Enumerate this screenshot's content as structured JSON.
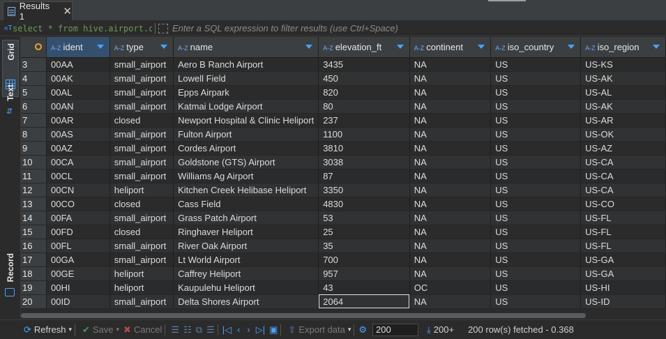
{
  "tab": {
    "label": "Results 1",
    "close": "✕"
  },
  "filter": {
    "sql": "select * from hive.airport.codes",
    "placeholder": "Enter a SQL expression to filter results (use Ctrl+Space)"
  },
  "rail": {
    "grid": "Grid",
    "text": "Text",
    "record": "Record"
  },
  "columns": [
    "ident",
    "type",
    "name",
    "elevation_ft",
    "continent",
    "iso_country",
    "iso_region"
  ],
  "rows": [
    [
      "3",
      "00AA",
      "small_airport",
      "Aero B Ranch Airport",
      "3435",
      "NA",
      "US",
      "US-KS"
    ],
    [
      "4",
      "00AK",
      "small_airport",
      "Lowell Field",
      "450",
      "NA",
      "US",
      "US-AK"
    ],
    [
      "5",
      "00AL",
      "small_airport",
      "Epps Airpark",
      "820",
      "NA",
      "US",
      "US-AL"
    ],
    [
      "6",
      "00AN",
      "small_airport",
      "Katmai Lodge Airport",
      "80",
      "NA",
      "US",
      "US-AK"
    ],
    [
      "7",
      "00AR",
      "closed",
      "Newport Hospital & Clinic Heliport",
      "237",
      "NA",
      "US",
      "US-AR"
    ],
    [
      "8",
      "00AS",
      "small_airport",
      "Fulton Airport",
      "1100",
      "NA",
      "US",
      "US-OK"
    ],
    [
      "9",
      "00AZ",
      "small_airport",
      "Cordes Airport",
      "3810",
      "NA",
      "US",
      "US-AZ"
    ],
    [
      "10",
      "00CA",
      "small_airport",
      "Goldstone (GTS) Airport",
      "3038",
      "NA",
      "US",
      "US-CA"
    ],
    [
      "11",
      "00CL",
      "small_airport",
      "Williams Ag Airport",
      "87",
      "NA",
      "US",
      "US-CA"
    ],
    [
      "12",
      "00CN",
      "heliport",
      "Kitchen Creek Helibase Heliport",
      "3350",
      "NA",
      "US",
      "US-CA"
    ],
    [
      "13",
      "00CO",
      "closed",
      "Cass Field",
      "4830",
      "NA",
      "US",
      "US-CO"
    ],
    [
      "14",
      "00FA",
      "small_airport",
      "Grass Patch Airport",
      "53",
      "NA",
      "US",
      "US-FL"
    ],
    [
      "15",
      "00FD",
      "closed",
      "Ringhaver Heliport",
      "25",
      "NA",
      "US",
      "US-FL"
    ],
    [
      "16",
      "00FL",
      "small_airport",
      "River Oak Airport",
      "35",
      "NA",
      "US",
      "US-FL"
    ],
    [
      "17",
      "00GA",
      "small_airport",
      "Lt World Airport",
      "700",
      "NA",
      "US",
      "US-GA"
    ],
    [
      "18",
      "00GE",
      "heliport",
      "Caffrey Heliport",
      "957",
      "NA",
      "US",
      "US-GA"
    ],
    [
      "19",
      "00HI",
      "heliport",
      "Kaupulehu Heliport",
      "43",
      "OC",
      "US",
      "US-HI"
    ],
    [
      "20",
      "00ID",
      "small_airport",
      "Delta Shores Airport",
      "2064",
      "NA",
      "US",
      "US-ID"
    ]
  ],
  "toolbar": {
    "refresh": "Refresh",
    "save": "Save",
    "cancel": "Cancel",
    "export": "Export data",
    "fetch_size": "200",
    "fetch_count": "200+",
    "status": "200 row(s) fetched - 0.368"
  },
  "colors": {
    "accent": "#4aa3ff",
    "sql_text": "#6a9955",
    "header_bg": "#3c3f41",
    "sorted_header": "#34506e"
  }
}
